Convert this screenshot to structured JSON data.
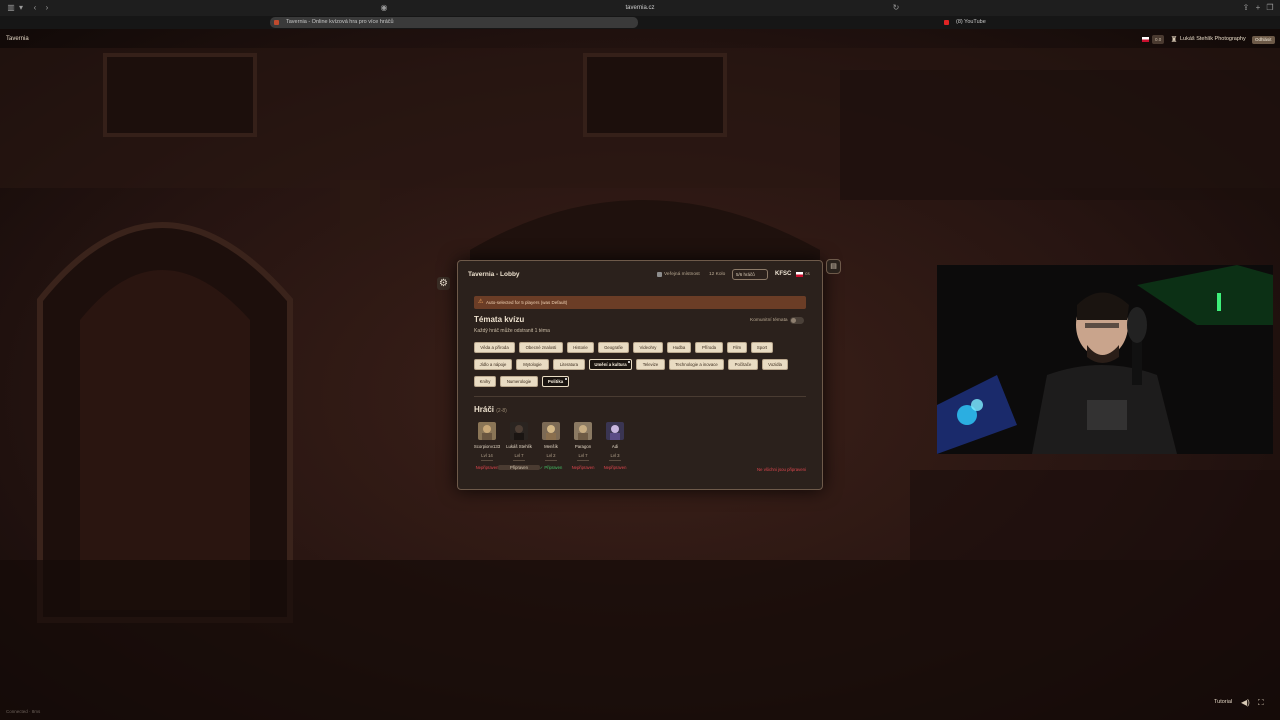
{
  "browser": {
    "url": "tavernia.cz",
    "tabs": [
      {
        "title": "Tavernia - Online kvízová hra pro více hráčů",
        "active": true
      },
      {
        "title": "(8) YouTube",
        "active": false
      }
    ]
  },
  "site": {
    "brand": "Tavernia",
    "user": "Lukáš Stehlík Photography",
    "logout": "Odhlásit",
    "lang": "CS",
    "hdr_box": "0.0"
  },
  "lobby": {
    "title": "Tavernia - Lobby",
    "public_room": "Veřejná místnost",
    "rounds": "12 Kolo",
    "players_pill": "5/6 hráčů",
    "room_code": "KFSC",
    "lang": "cs",
    "alert": "Auto-selected for 5 players (was Default)",
    "topics_title": "Témata kvízu",
    "topics_sub": "Každý hráč může odstranit 1 téma",
    "community_label": "Komunitní témata",
    "topics": [
      {
        "label": "Věda a příroda",
        "selected": false
      },
      {
        "label": "Obecné znalosti",
        "selected": false
      },
      {
        "label": "Historie",
        "selected": false
      },
      {
        "label": "Geografie",
        "selected": false
      },
      {
        "label": "Videohry",
        "selected": false
      },
      {
        "label": "Hudba",
        "selected": false
      },
      {
        "label": "Příroda",
        "selected": false
      },
      {
        "label": "Film",
        "selected": false
      },
      {
        "label": "Sport",
        "selected": false
      },
      {
        "label": "Jídlo a nápoje",
        "selected": false
      },
      {
        "label": "Mytologie",
        "selected": false
      },
      {
        "label": "Literatura",
        "selected": false
      },
      {
        "label": "Umění a kultura",
        "selected": true
      },
      {
        "label": "Televize",
        "selected": false
      },
      {
        "label": "Technologie a inovace",
        "selected": false
      },
      {
        "label": "Počítače",
        "selected": false
      },
      {
        "label": "Vozidla",
        "selected": false
      },
      {
        "label": "Knihy",
        "selected": false
      },
      {
        "label": "Numerologie",
        "selected": false
      },
      {
        "label": "Politika",
        "selected": true
      }
    ],
    "players_title": "Hráči",
    "players_count": "(2-8)",
    "players": [
      {
        "name": "Scorpionv133",
        "level": "Lvl 14",
        "status": "Nepřipraven",
        "state": "not"
      },
      {
        "name": "Lukáš Stehlík",
        "level": "Lvl 7",
        "status": "Připraven",
        "state": "me"
      },
      {
        "name": "Menšík",
        "level": "Lvl 2",
        "status": "✓ Připraven",
        "state": "ok"
      },
      {
        "name": "Paragon",
        "level": "Lvl 7",
        "status": "Nepřipraven",
        "state": "not"
      },
      {
        "name": "Adi",
        "level": "Lvl 3",
        "status": "Nepřipraven",
        "state": "not"
      }
    ],
    "not_all_ready": "Ne všichni jsou připraveni"
  },
  "footer": {
    "connection": "Connected · 8ms",
    "tutorial": "Tutorial"
  },
  "icons": [
    "sidebar-icon",
    "back-icon",
    "forward-icon",
    "shield-icon",
    "reload-icon",
    "share-icon",
    "new-tab-icon",
    "tabs-icon",
    "gear-icon",
    "chat-icon",
    "warning-icon",
    "book-icon",
    "volume-icon",
    "fullscreen-icon"
  ],
  "colors": {
    "accent": "#e9dcc3",
    "alert_bg": "#6b3d26",
    "not_ready": "#e0464e",
    "ready": "#43c165"
  }
}
